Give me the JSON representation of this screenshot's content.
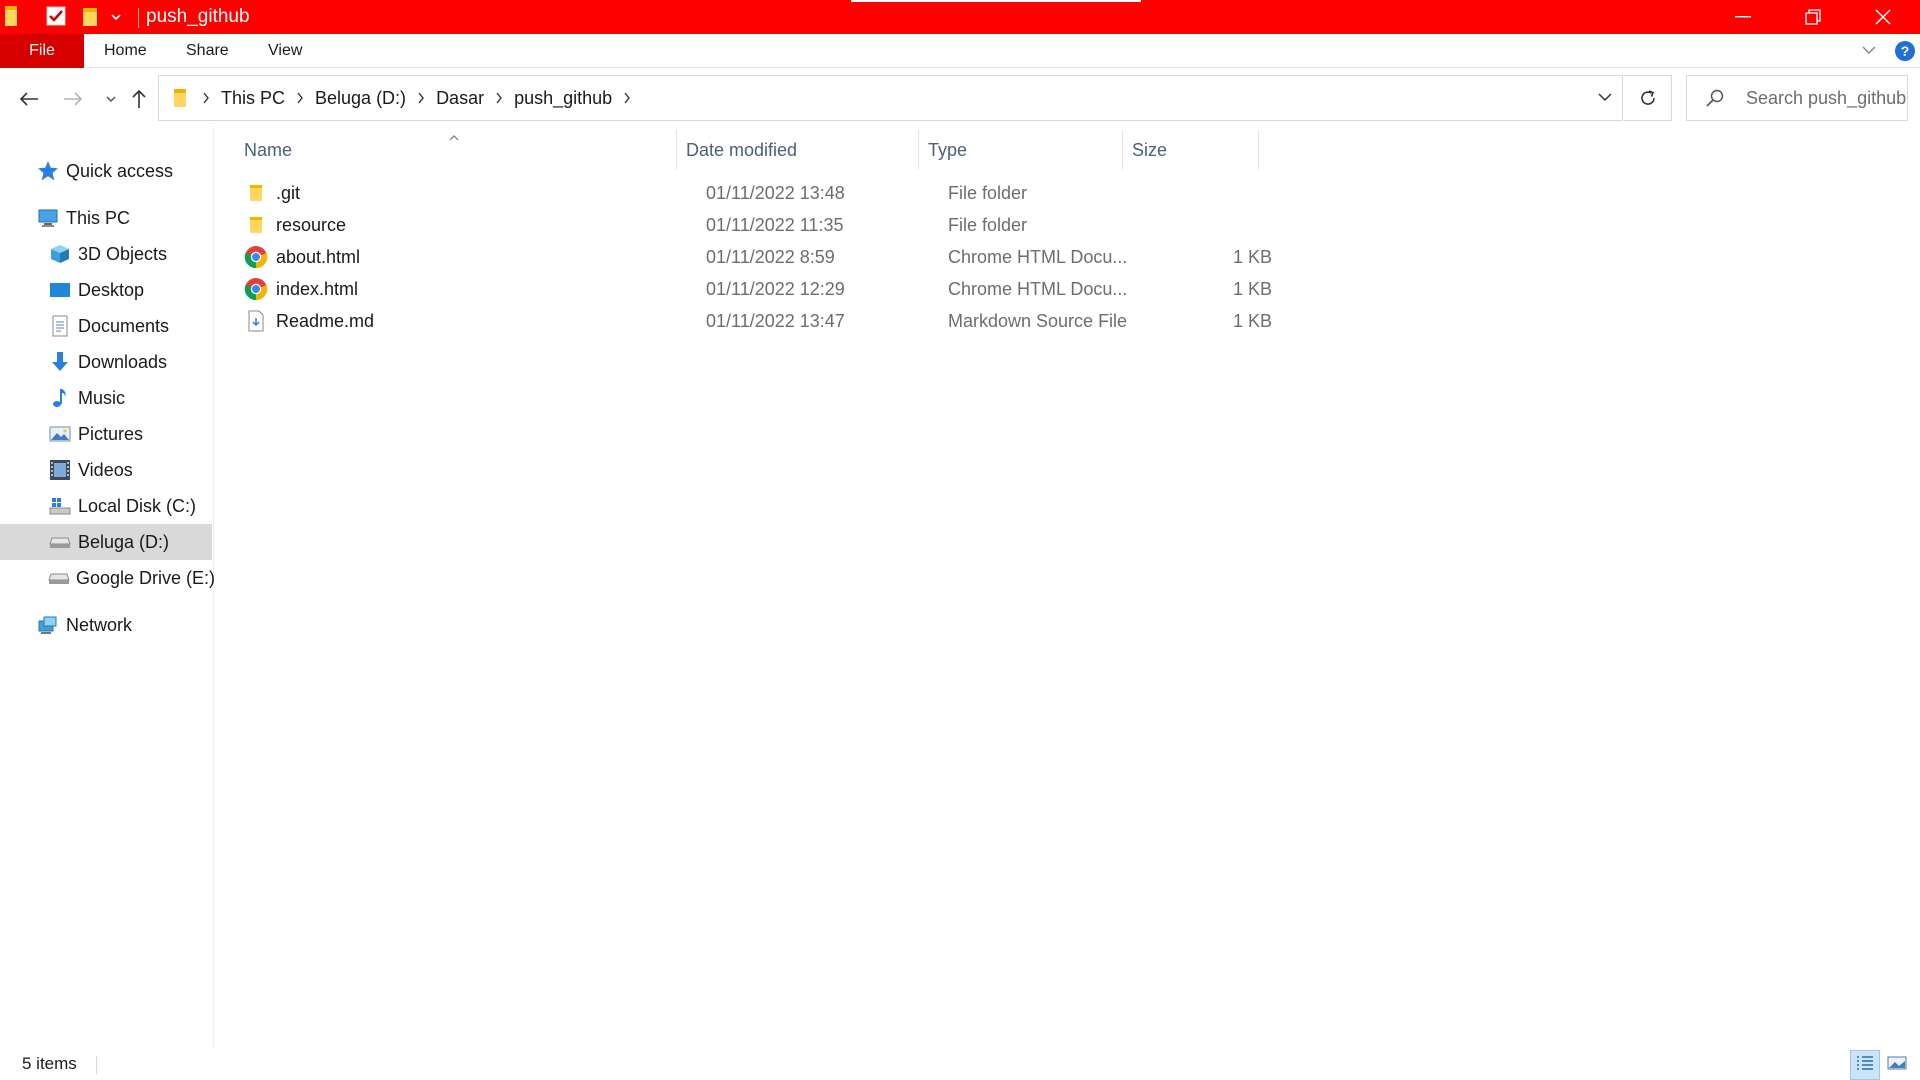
{
  "window": {
    "title": "push_github",
    "accent_color": "#ff0000",
    "file_tab_color": "#d60000"
  },
  "ribbon": {
    "file_label": "File",
    "tabs": [
      "Home",
      "Share",
      "View"
    ]
  },
  "address_bar": {
    "breadcrumbs": [
      "This PC",
      "Beluga (D:)",
      "Dasar",
      "push_github"
    ]
  },
  "search": {
    "placeholder": "Search push_github"
  },
  "sidebar": {
    "items": [
      {
        "label": "Quick access",
        "icon": "star-icon"
      },
      {
        "label": "This PC",
        "icon": "computer-icon"
      },
      {
        "label": "3D Objects",
        "icon": "cube-icon"
      },
      {
        "label": "Desktop",
        "icon": "desktop-icon"
      },
      {
        "label": "Documents",
        "icon": "document-icon"
      },
      {
        "label": "Downloads",
        "icon": "download-arrow-icon"
      },
      {
        "label": "Music",
        "icon": "music-note-icon"
      },
      {
        "label": "Pictures",
        "icon": "picture-icon"
      },
      {
        "label": "Videos",
        "icon": "film-icon"
      },
      {
        "label": "Local Disk (C:)",
        "icon": "windows-drive-icon"
      },
      {
        "label": "Beluga (D:)",
        "icon": "drive-icon",
        "selected": true
      },
      {
        "label": "Google Drive (E:)",
        "icon": "drive-icon"
      },
      {
        "label": "Network",
        "icon": "network-icon"
      }
    ]
  },
  "file_list": {
    "columns": [
      "Name",
      "Date modified",
      "Type",
      "Size"
    ],
    "rows": [
      {
        "name": ".git",
        "date": "01/11/2022 13:48",
        "type": "File folder",
        "size": "",
        "icon": "folder-icon"
      },
      {
        "name": "resource",
        "date": "01/11/2022 11:35",
        "type": "File folder",
        "size": "",
        "icon": "folder-icon"
      },
      {
        "name": "about.html",
        "date": "01/11/2022 8:59",
        "type": "Chrome HTML Docu...",
        "size": "1 KB",
        "icon": "chrome-icon"
      },
      {
        "name": "index.html",
        "date": "01/11/2022 12:29",
        "type": "Chrome HTML Docu...",
        "size": "1 KB",
        "icon": "chrome-icon"
      },
      {
        "name": "Readme.md",
        "date": "01/11/2022 13:47",
        "type": "Markdown Source File",
        "size": "1 KB",
        "icon": "markdown-file-icon"
      }
    ]
  },
  "status_bar": {
    "item_count": "5 items"
  }
}
